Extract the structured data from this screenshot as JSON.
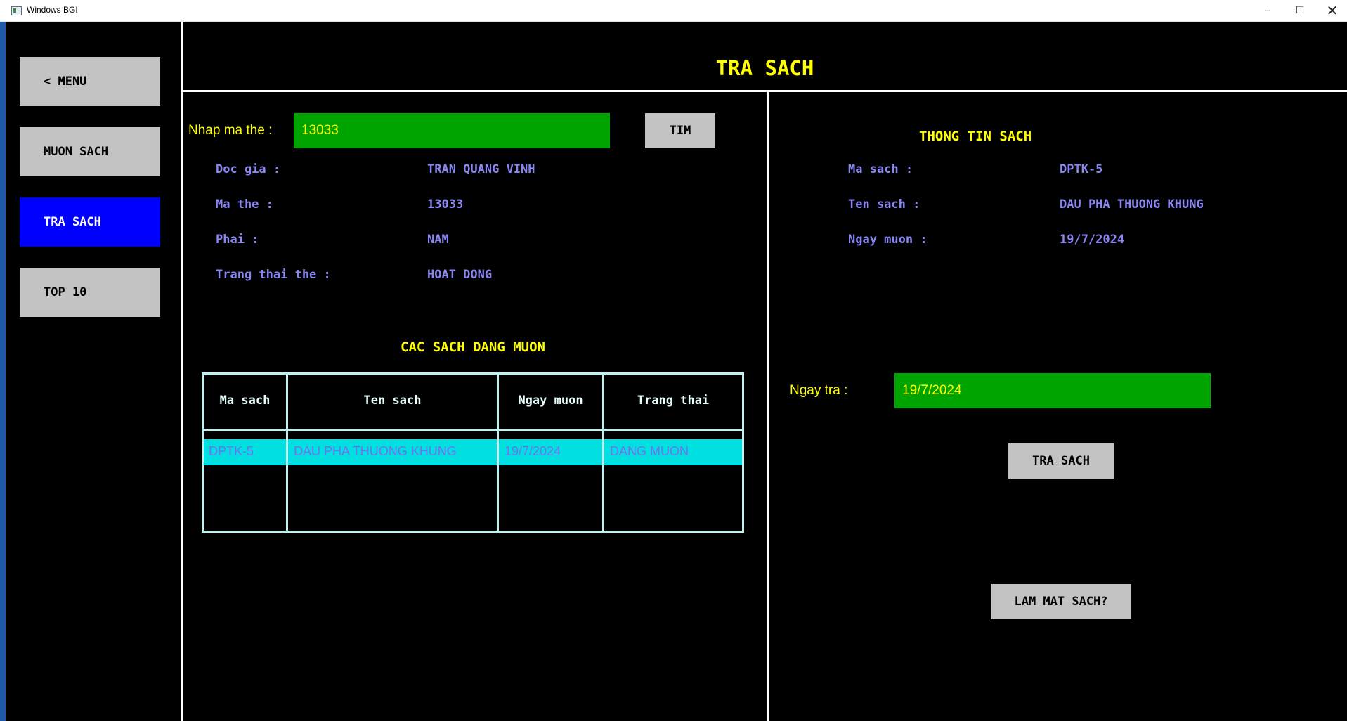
{
  "window": {
    "title": "Windows BGI",
    "controls": {
      "minimize": "–",
      "maximize": "☐",
      "close": "✕"
    }
  },
  "sidebar": {
    "menu": "< MENU",
    "items": [
      {
        "label": "MUON SACH"
      },
      {
        "label": "TRA SACH",
        "active": true
      },
      {
        "label": "TOP 10"
      }
    ]
  },
  "header": {
    "title": "TRA SACH"
  },
  "search": {
    "label": "Nhap ma the :",
    "value": "13033",
    "button": "TIM"
  },
  "reader": {
    "name_label": "Doc gia :",
    "name": "TRAN QUANG VINH",
    "card_label": "Ma the :",
    "card": "13033",
    "gender_label": "Phai :",
    "gender": "NAM",
    "status_label": "Trang thai the :",
    "status": "HOAT DONG"
  },
  "borrowed": {
    "title": "CAC SACH DANG MUON",
    "columns": [
      "Ma sach",
      "Ten sach",
      "Ngay muon",
      "Trang thai"
    ],
    "rows": [
      [
        "DPTK-5",
        "DAU PHA THUONG KHUNG",
        "19/7/2024",
        "DANG MUON"
      ]
    ]
  },
  "book_info": {
    "title": "THONG TIN SACH",
    "code_label": "Ma sach :",
    "code": "DPTK-5",
    "name_label": "Ten sach :",
    "name": "DAU PHA THUONG KHUNG",
    "date_label": "Ngay muon :",
    "date": "19/7/2024"
  },
  "return": {
    "label": "Ngay tra :",
    "value": "19/7/2024",
    "button": "TRA SACH"
  },
  "lost_button": "LAM MAT SACH?",
  "colors": {
    "background": "#000000",
    "active_nav": "#0000ff",
    "button": "#c3c3c3",
    "input": "#00a400",
    "title": "#ffff00",
    "label": "#8a86f2",
    "selected_row": "#00e0e0"
  }
}
